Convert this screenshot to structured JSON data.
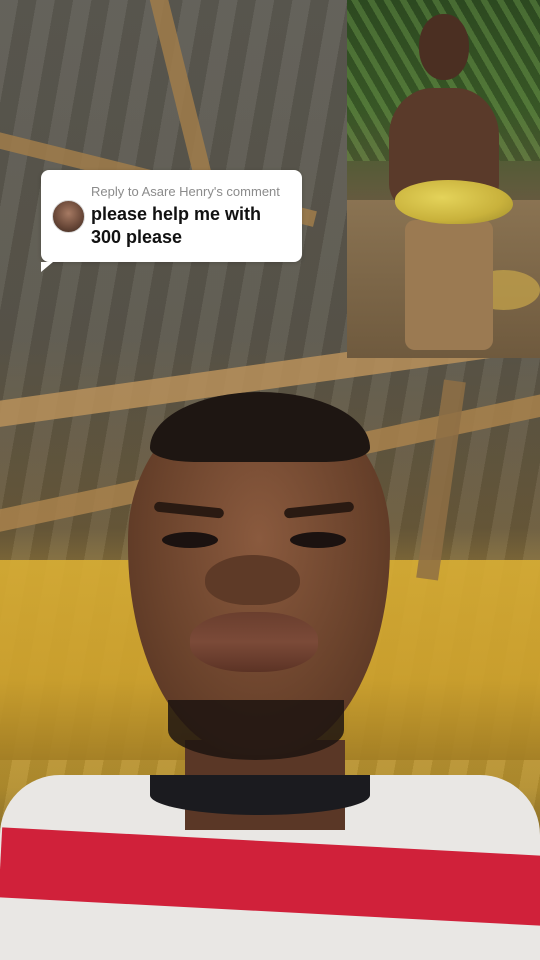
{
  "reply_bubble": {
    "header": "Reply to Asare Henry's comment",
    "comment_text": "please help me with 300 please"
  },
  "colors": {
    "bubble_bg": "#ffffff",
    "header_text": "#8b8b8b",
    "comment_text": "#111111"
  }
}
